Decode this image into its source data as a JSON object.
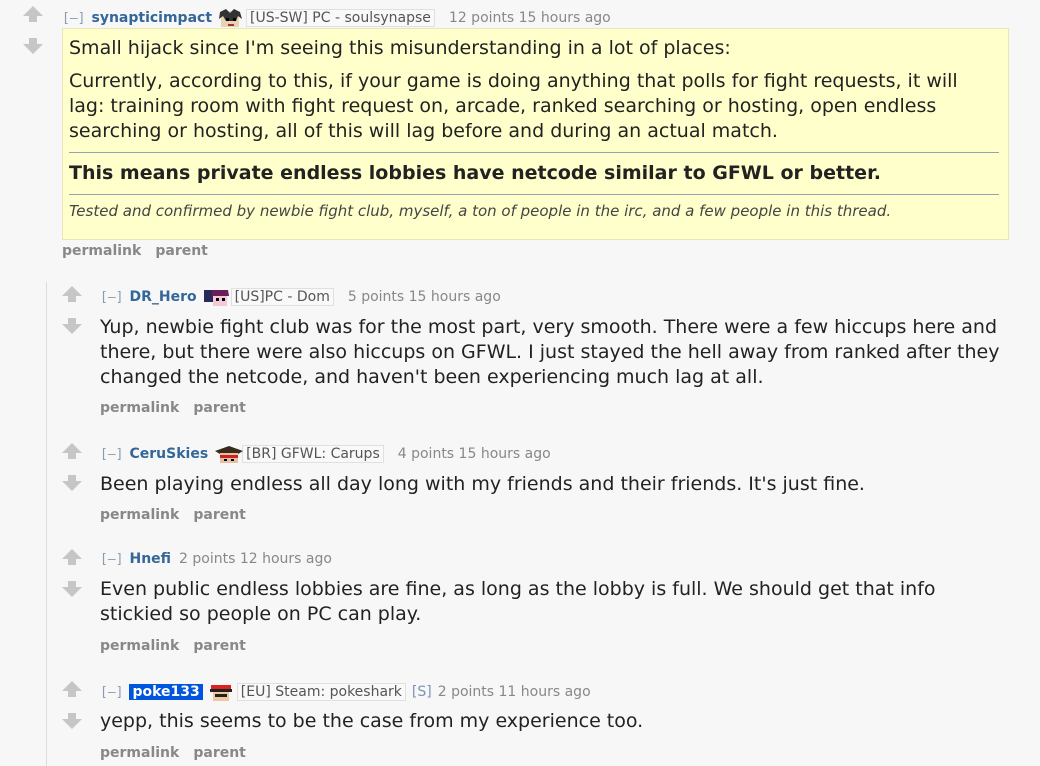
{
  "comments": [
    {
      "collapse": "[–]",
      "author": "synapticimpact",
      "flair": "[US-SW] PC - soulsynapse",
      "score_time": "12 points 15 hours ago",
      "paragraphs": [
        "Small hijack since I'm seeing this misunderstanding in a lot of places:",
        "Currently, according to this, if your game is doing anything that polls for fight requests, it will lag: training room with fight request on, arcade, ranked searching or hosting, open endless searching or hosting, all of this will lag before and during an actual match."
      ],
      "bold_line": "This means private endless lobbies have netcode similar to GFWL or better.",
      "italic_line": "Tested and confirmed by newbie fight club, myself, a ton of people in the irc, and a few people in this thread.",
      "permalink": "permalink",
      "parent": "parent"
    },
    {
      "collapse": "[–]",
      "author": "DR_Hero",
      "flair": "[US]PC - Dom",
      "score_time": "5 points 15 hours ago",
      "text": "Yup, newbie fight club was for the most part, very smooth. There were a few hiccups here and there, but there were also hiccups on GFWL. I just stayed the hell away from ranked after they changed the netcode, and haven't been experiencing much lag at all.",
      "permalink": "permalink",
      "parent": "parent"
    },
    {
      "collapse": "[–]",
      "author": "CeruSkies",
      "flair": "[BR] GFWL: Carups",
      "score_time": "4 points 15 hours ago",
      "text": "Been playing endless all day long with my friends and their friends. It's just fine.",
      "permalink": "permalink",
      "parent": "parent"
    },
    {
      "collapse": "[–]",
      "author": "Hnefi",
      "score_time": "2 points 12 hours ago",
      "text": "Even public endless lobbies are fine, as long as the lobby is full. We should get that info stickied so people on PC can play.",
      "permalink": "permalink",
      "parent": "parent"
    },
    {
      "collapse": "[–]",
      "author": "poke133",
      "flair": "[EU] Steam: pokeshark",
      "stickied": "[S]",
      "score_time": "2 points 11 hours ago",
      "text": "yepp, this seems to be the case from my experience too.",
      "permalink": "permalink",
      "parent": "parent"
    }
  ],
  "colors": {
    "background": "#f7f7f7",
    "highlight_box": "#ffffcc",
    "author": "#336699",
    "highlighted_author_bg": "#0055df"
  }
}
